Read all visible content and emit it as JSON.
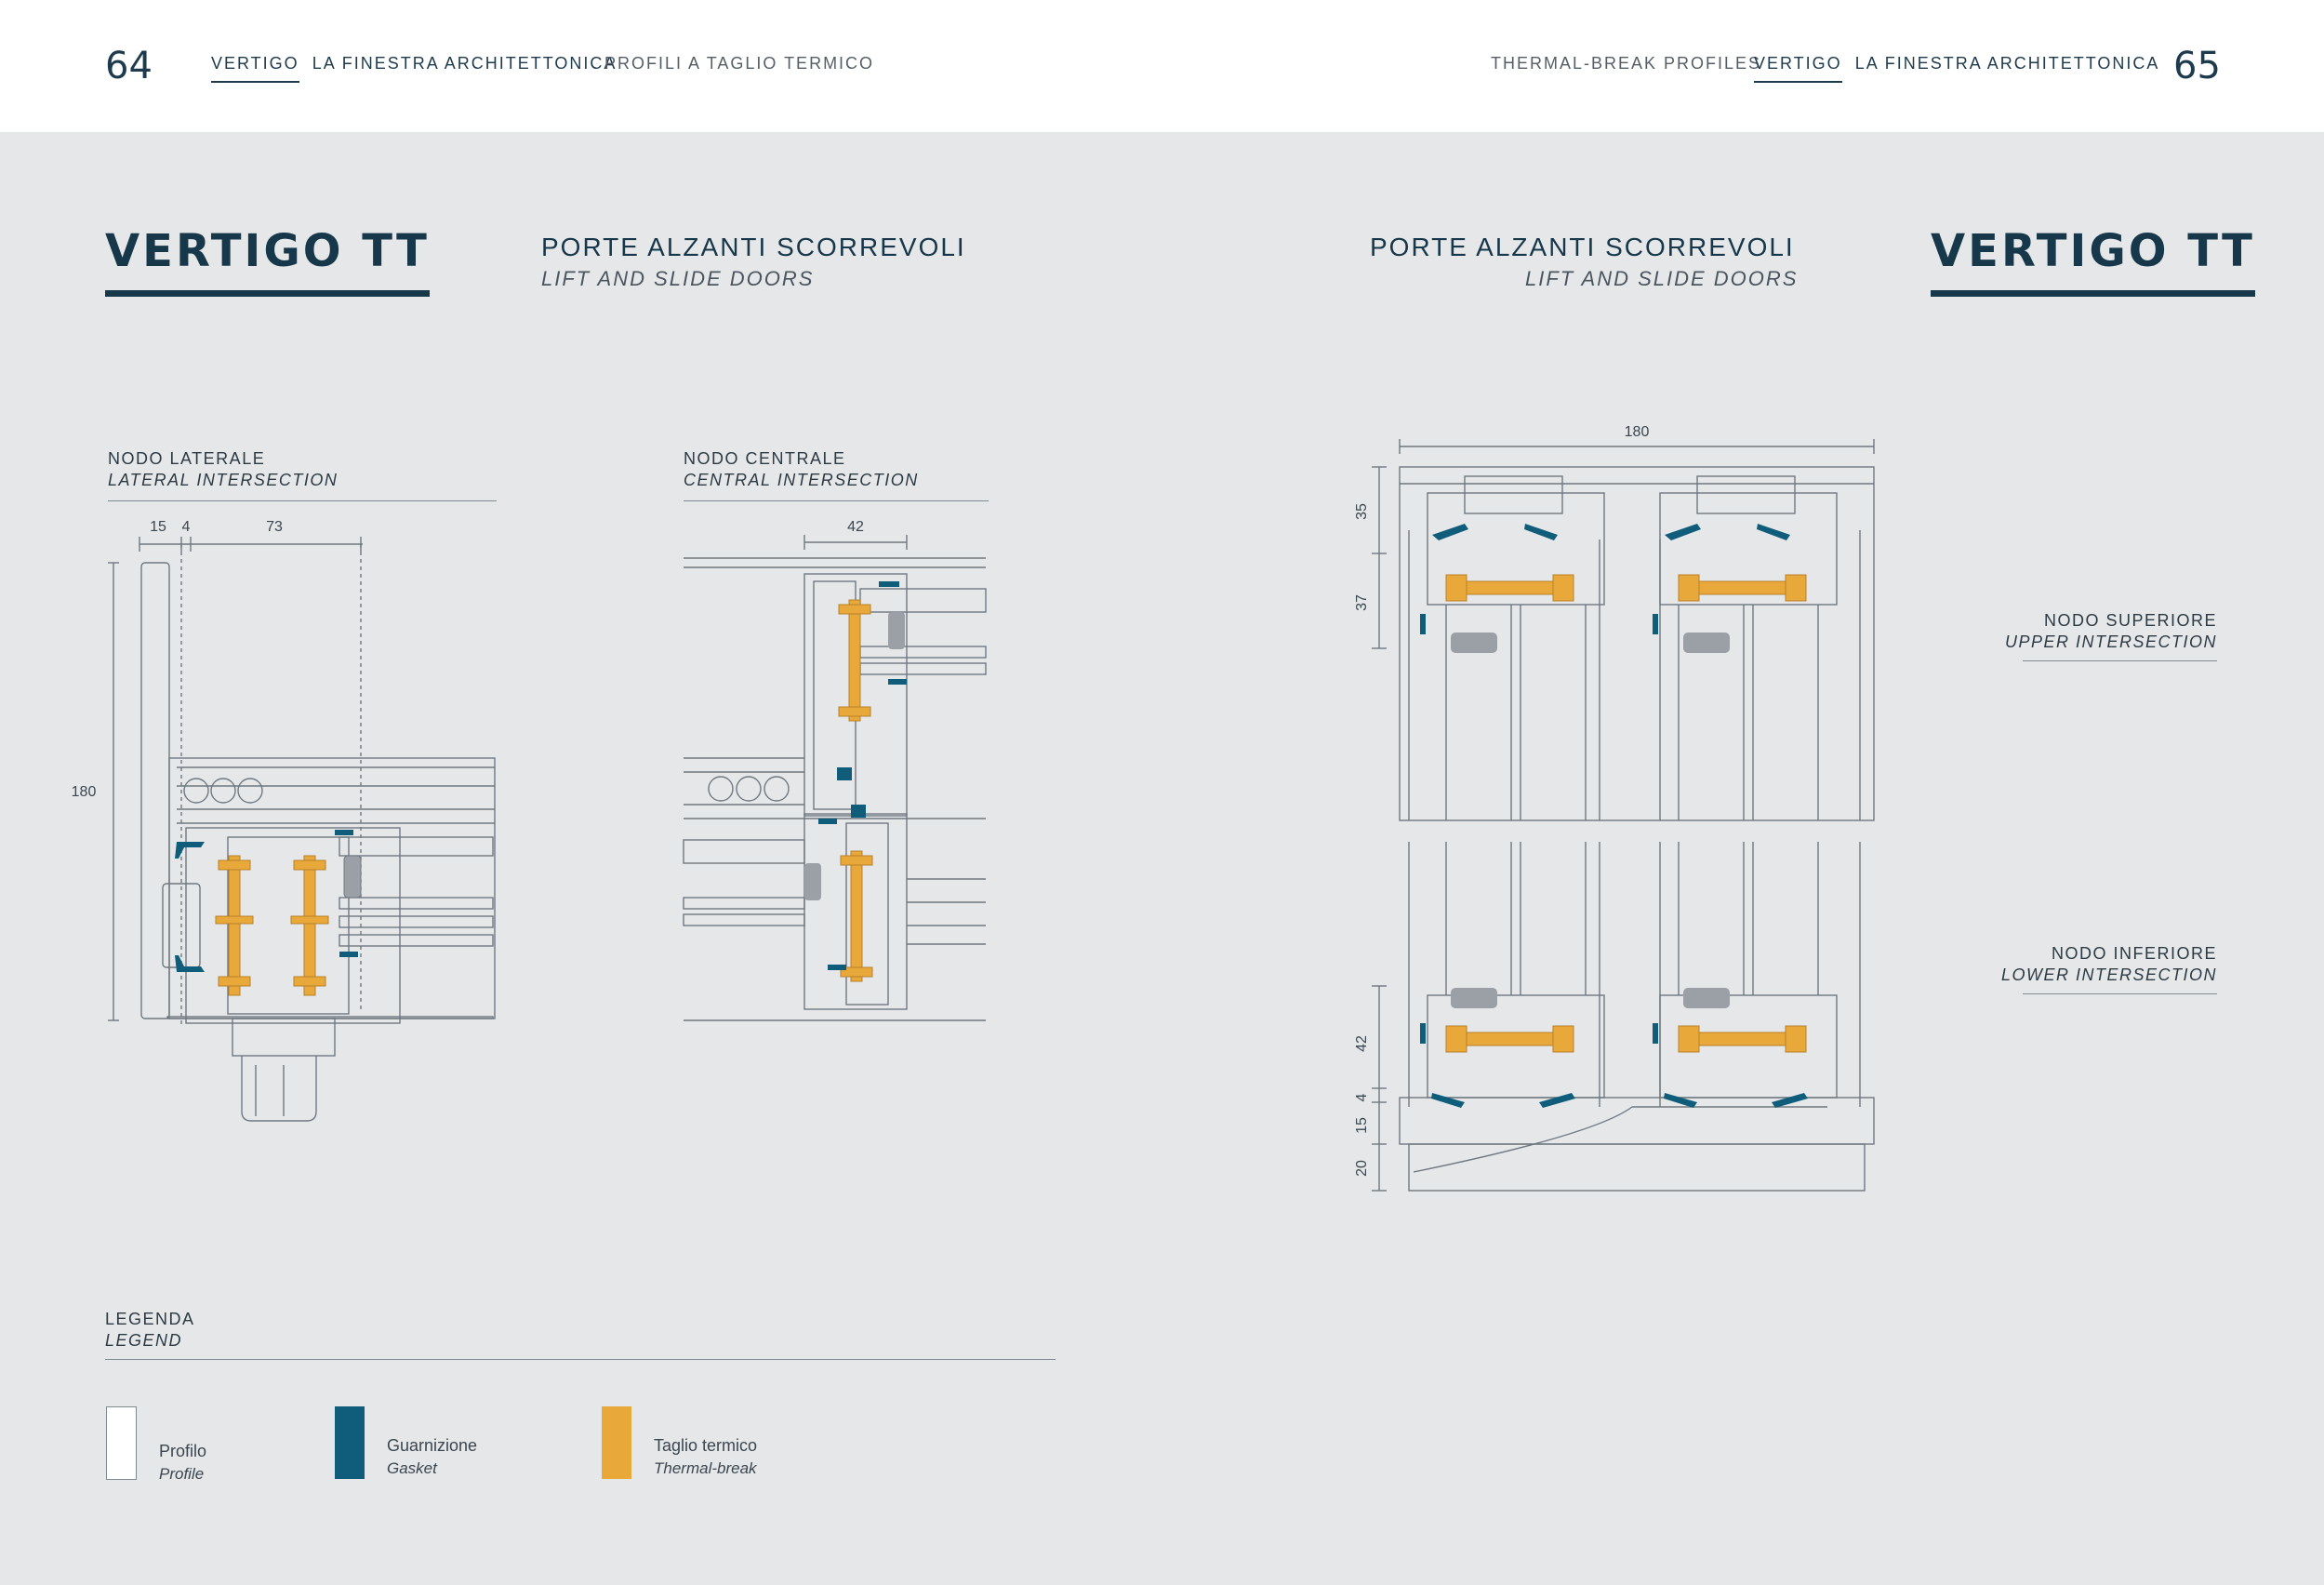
{
  "header": {
    "left": {
      "page_number": "64",
      "brand": "VERTIGO",
      "title": "LA FINESTRA ARCHITETTONICA",
      "section": "PROFILI A TAGLIO TERMICO"
    },
    "right": {
      "page_number": "65",
      "brand": "VERTIGO",
      "title": "LA FINESTRA ARCHITETTONICA",
      "section": "THERMAL-BREAK PROFILES"
    }
  },
  "left_page": {
    "product_title": "VERTIGO TT",
    "subtitle": "PORTE ALZANTI SCORREVOLI",
    "subtitle_en": "LIFT AND SLIDE DOORS",
    "nodes": [
      {
        "label": "NODO LATERALE",
        "label_en": "LATERAL INTERSECTION",
        "dims": [
          "15",
          "4",
          "73",
          "180"
        ]
      },
      {
        "label": "NODO CENTRALE",
        "label_en": "CENTRAL INTERSECTION",
        "dims": [
          "42"
        ]
      }
    ],
    "legend": {
      "title": "LEGENDA",
      "title_en": "LEGEND",
      "items": [
        {
          "label": "Profilo",
          "label_en": "Profile",
          "color": "#ffffff"
        },
        {
          "label": "Guarnizione",
          "label_en": "Gasket",
          "color": "#0f5d7a"
        },
        {
          "label": "Taglio termico",
          "label_en": "Thermal-break",
          "color": "#e8a83a"
        }
      ]
    }
  },
  "right_page": {
    "product_title": "VERTIGO TT",
    "subtitle": "PORTE ALZANTI SCORREVOLI",
    "subtitle_en": "LIFT AND SLIDE DOORS",
    "nodes": [
      {
        "label": "NODO SUPERIORE",
        "label_en": "UPPER INTERSECTION",
        "dims": [
          "180",
          "35",
          "37"
        ]
      },
      {
        "label": "NODO INFERIORE",
        "label_en": "LOWER INTERSECTION",
        "dims": [
          "42",
          "4",
          "15",
          "20"
        ]
      }
    ]
  },
  "colors": {
    "navy": "#17374a",
    "gasket": "#0f5d7a",
    "thermal": "#e8a83a",
    "background": "#e6e7e9"
  }
}
